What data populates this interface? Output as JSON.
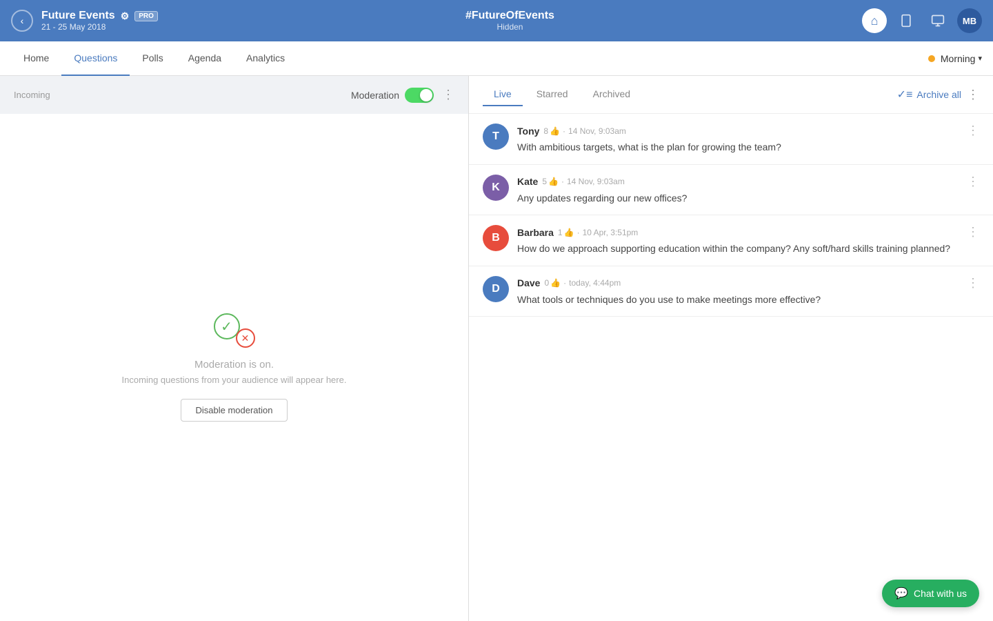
{
  "header": {
    "back_label": "‹",
    "event_title": "Future Events",
    "event_dates": "21 - 25 May 2018",
    "pro_badge": "PRO",
    "hashtag": "#FutureOfEvents",
    "hidden_label": "Hidden",
    "home_icon": "⌂",
    "device_icon": "▭",
    "screen_icon": "▢",
    "avatar_initials": "MB"
  },
  "nav": {
    "items": [
      {
        "label": "Home",
        "active": false
      },
      {
        "label": "Questions",
        "active": true
      },
      {
        "label": "Polls",
        "active": false
      },
      {
        "label": "Agenda",
        "active": false
      },
      {
        "label": "Analytics",
        "active": false
      }
    ],
    "morning_label": "Morning"
  },
  "left_panel": {
    "incoming_label": "Incoming",
    "moderation_label": "Moderation",
    "moderation_on": true,
    "moderation_title": "Moderation is on.",
    "moderation_desc": "Incoming questions from your audience will appear here.",
    "disable_btn": "Disable moderation"
  },
  "right_panel": {
    "tabs": [
      {
        "label": "Live",
        "active": true
      },
      {
        "label": "Starred",
        "active": false
      },
      {
        "label": "Archived",
        "active": false
      }
    ],
    "archive_all_label": "Archive all",
    "questions": [
      {
        "id": "tony",
        "name": "Tony",
        "avatar_initial": "T",
        "avatar_color": "#4a7bbf",
        "likes": 8,
        "date": "14 Nov, 9:03am",
        "text": "With ambitious targets, what is the plan for growing the team?"
      },
      {
        "id": "kate",
        "name": "Kate",
        "avatar_initial": "K",
        "avatar_color": "#7b5ea7",
        "likes": 5,
        "date": "14 Nov, 9:03am",
        "text": "Any updates regarding our new offices?"
      },
      {
        "id": "barbara",
        "name": "Barbara",
        "avatar_initial": "B",
        "avatar_color": "#e74c3c",
        "likes": 1,
        "date": "10 Apr, 3:51pm",
        "text": "How do we approach supporting education within the company? Any soft/hard skills training planned?"
      },
      {
        "id": "dave",
        "name": "Dave",
        "avatar_initial": "D",
        "avatar_color": "#4a7bbf",
        "likes": 0,
        "date": "today, 4:44pm",
        "text": "What tools or techniques do you use to make meetings more effective?"
      }
    ]
  },
  "chat_widget": {
    "label": "Chat with us"
  }
}
